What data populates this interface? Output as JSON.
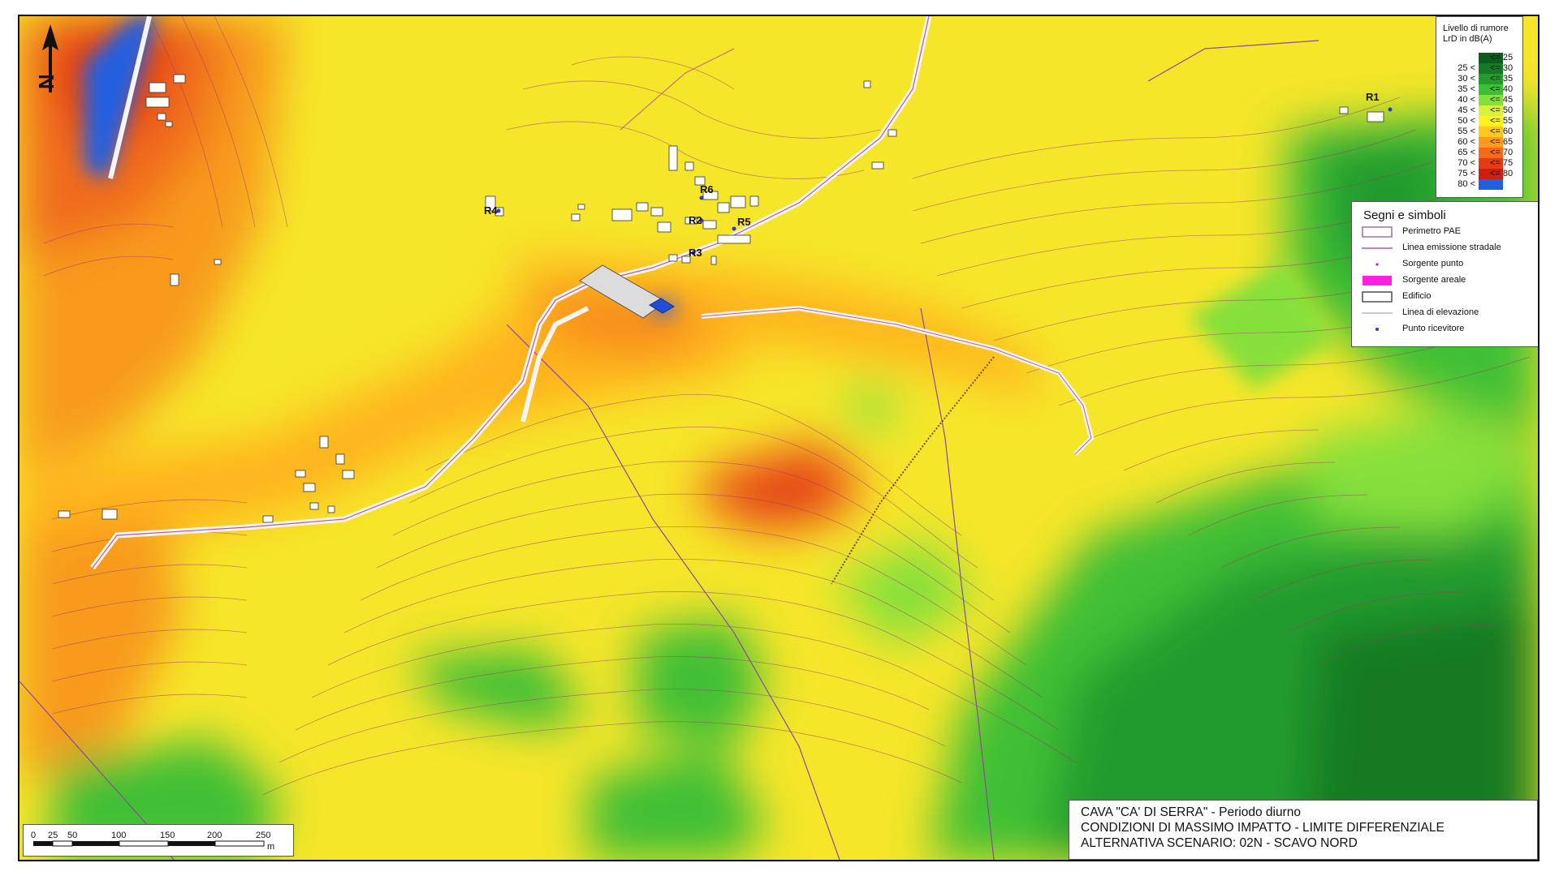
{
  "legend_noise": {
    "title_line1": "Livello di rumore",
    "title_line2": "LrD in dB(A)",
    "classes": [
      {
        "lo": "",
        "hi": "<= 25",
        "color": "#0a5c1e"
      },
      {
        "lo": "25 <",
        "hi": "<= 30",
        "color": "#157a24"
      },
      {
        "lo": "30 <",
        "hi": "<= 35",
        "color": "#239b2d"
      },
      {
        "lo": "35 <",
        "hi": "<= 40",
        "color": "#3fbf34"
      },
      {
        "lo": "40 <",
        "hi": "<= 45",
        "color": "#86e03a"
      },
      {
        "lo": "45 <",
        "hi": "<= 50",
        "color": "#d9f23c"
      },
      {
        "lo": "50 <",
        "hi": "<= 55",
        "color": "#fff21e"
      },
      {
        "lo": "55 <",
        "hi": "<= 60",
        "color": "#ffc81c"
      },
      {
        "lo": "60 <",
        "hi": "<= 65",
        "color": "#ff9a1c"
      },
      {
        "lo": "65 <",
        "hi": "<= 70",
        "color": "#f86a1a"
      },
      {
        "lo": "70 <",
        "hi": "<= 75",
        "color": "#e63c16"
      },
      {
        "lo": "75 <",
        "hi": "<= 80",
        "color": "#cf1d12"
      },
      {
        "lo": "80 <",
        "hi": "",
        "color": "#2060e0"
      }
    ]
  },
  "legend_symbols": {
    "title": "Segni e simboli",
    "items": [
      {
        "label": "Perimetro PAE",
        "icon": "perimeter-icon"
      },
      {
        "label": "Linea emissione stradale",
        "icon": "road-line-icon"
      },
      {
        "label": "Sorgente punto",
        "icon": "point-source-icon"
      },
      {
        "label": "Sorgente areale",
        "icon": "area-source-icon"
      },
      {
        "label": "Edificio",
        "icon": "building-icon"
      },
      {
        "label": "Linea di elevazione",
        "icon": "elevation-line-icon"
      },
      {
        "label": "Punto ricevitore",
        "icon": "receiver-point-icon"
      }
    ]
  },
  "receivers": [
    "R1",
    "R2",
    "R3",
    "R4",
    "R5",
    "R6"
  ],
  "north_label": "N",
  "scale_bar": {
    "ticks": [
      "0",
      "25",
      "50",
      "100",
      "150",
      "200",
      "250"
    ],
    "unit": "m"
  },
  "title_box": {
    "line1": "CAVA \"CA' DI SERRA\" - Periodo diurno",
    "line2": "CONDIZIONI DI MASSIMO IMPATTO - LIMITE DIFFERENZIALE",
    "line3": "ALTERNATIVA SCENARIO: 02N - SCAVO NORD"
  },
  "colors": {
    "contour": "#9a3a6a",
    "road": "#f2f2f2",
    "perimeter": "#8a4aa0"
  }
}
